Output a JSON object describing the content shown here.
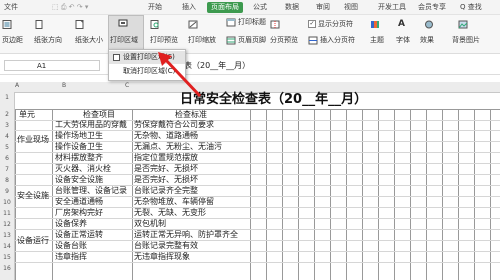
{
  "menubar": {
    "file": "文件",
    "items": [
      "开始",
      "插入",
      "页面布局",
      "公式",
      "数据",
      "审阅",
      "视图",
      "开发工具",
      "会员专享"
    ],
    "search": "Q 查找"
  },
  "ribbon": {
    "margins": "页边距",
    "orientation": "纸张方向",
    "size": "纸张大小",
    "print_area": "打印区域",
    "print_preview": "打印预览",
    "print_scale": "打印缩放",
    "print_titles": "打印标题",
    "header_footer": "页眉页脚",
    "show_page_breaks": "显示分页符",
    "insert_page_break": "插入分页符",
    "page_preview": "分页预览",
    "theme": "主题",
    "fonts": "字体",
    "effects": "效果",
    "background": "背景图片"
  },
  "formula_bar": {
    "cell_ref": "A1",
    "content": "表（20__年__月）"
  },
  "dropdown": {
    "set_area": "设置打印区域(S)",
    "cancel_area": "取消打印区域(C)"
  },
  "sheet": {
    "title": "日常安全检查表（20__年__月）",
    "header": [
      "单元",
      "检查项目",
      "检查标准"
    ],
    "rows": [
      [
        "",
        "工大劳保用品的穿戴",
        "劳保穿戴符合公司要求"
      ],
      [
        "作业现场",
        "操作场地卫生",
        "无杂物、道路通畅"
      ],
      [
        "",
        "操作设备卫生",
        "无漏点、无粉尘、无油污"
      ],
      [
        "",
        "材料摆放整齐",
        "指定位置规范摆放"
      ],
      [
        "",
        "灭火器、消火栓",
        "是否完好、无损坏"
      ],
      [
        "",
        "设备安全设施",
        "是否完好、无损坏"
      ],
      [
        "安全设施",
        "台账管理、设备记录",
        "台账记录齐全完整"
      ],
      [
        "",
        "安全通道通畅",
        "无杂物堆放、车辆停留"
      ],
      [
        "",
        "厂房架构完好",
        "无裂、无缺、无变形"
      ],
      [
        "",
        "设备保养",
        "双包机制"
      ],
      [
        "设备运行",
        "设备正常运转",
        "运转正常无异响、防护罩齐全"
      ],
      [
        "",
        "设备台账",
        "台账记录完整有效"
      ],
      [
        "",
        "违章指挥",
        "无违章指挥现象"
      ]
    ],
    "row_numbers": [
      "1",
      "2",
      "3",
      "4",
      "5",
      "6",
      "7",
      "8",
      "9",
      "10",
      "11",
      "12",
      "13",
      "14",
      "15",
      "16"
    ],
    "columns": [
      "A",
      "B",
      "C",
      "D",
      "E",
      "F",
      "G",
      "H",
      "I",
      "J",
      "K",
      "L",
      "M",
      "N",
      "O",
      "P"
    ]
  },
  "colors": {
    "accent": "#3d9a4f",
    "arrow": "#e02020"
  }
}
